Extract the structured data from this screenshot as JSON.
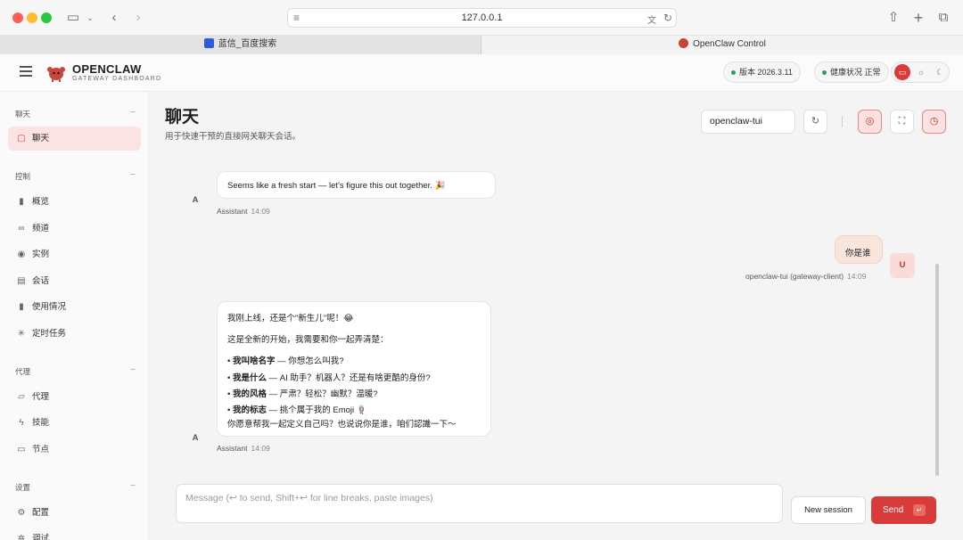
{
  "browser": {
    "url": "127.0.0.1",
    "tabs": [
      {
        "title": "蓝信_百度搜索"
      },
      {
        "title": "OpenClaw Control"
      }
    ]
  },
  "header": {
    "brand": "OPENCLAW",
    "brand_sub": "GATEWAY DASHBOARD",
    "version_label": "版本 2026.3.11",
    "health_label": "健康状况 正常"
  },
  "sidebar": {
    "sections": [
      {
        "title": "聊天",
        "items": [
          {
            "label": "聊天",
            "icon": "chat-icon",
            "active": true
          }
        ]
      },
      {
        "title": "控制",
        "items": [
          {
            "label": "概览",
            "icon": "bar-chart-icon"
          },
          {
            "label": "频道",
            "icon": "link-icon"
          },
          {
            "label": "实例",
            "icon": "broadcast-icon"
          },
          {
            "label": "会话",
            "icon": "document-icon"
          },
          {
            "label": "使用情况",
            "icon": "bar-chart-icon"
          },
          {
            "label": "定时任务",
            "icon": "loader-icon"
          }
        ]
      },
      {
        "title": "代理",
        "items": [
          {
            "label": "代理",
            "icon": "folder-icon"
          },
          {
            "label": "技能",
            "icon": "bolt-icon"
          },
          {
            "label": "节点",
            "icon": "monitor-icon"
          }
        ]
      },
      {
        "title": "设置",
        "items": [
          {
            "label": "配置",
            "icon": "gear-icon"
          },
          {
            "label": "调试",
            "icon": "bug-icon"
          }
        ]
      }
    ]
  },
  "main": {
    "title": "聊天",
    "subtitle": "用于快速干预的直接网关聊天会话。",
    "session_value": "openclaw-tui"
  },
  "messages": [
    {
      "role": "assistant",
      "avatar": "A",
      "lines": [
        "Seems like a fresh start — let's figure this out together. 🎉"
      ],
      "sender": "Assistant",
      "time": "14:09"
    },
    {
      "role": "user",
      "avatar": "U",
      "lines": [
        "你是谁"
      ],
      "sender": "openclaw-tui (gateway-client)",
      "time": "14:09"
    },
    {
      "role": "assistant",
      "avatar": "A",
      "intro": "我刚上线，还是个\"新生儿\"呢！😂",
      "lead": "这是全新的开始，我需要和你一起弄清楚：",
      "bullets": [
        {
          "bold": "我叫啥名字",
          "rest": " — 你想怎么叫我?"
        },
        {
          "bold": "我是什么",
          "rest": " — AI 助手？机器人？还是有啥更酷的身份?"
        },
        {
          "bold": "我的风格",
          "rest": " — 严肃？轻松？幽默？温暖?"
        },
        {
          "bold": "我的标志",
          "rest": " — 挑个属于我的 Emoji 🪢"
        }
      ],
      "closing": "你愿意帮我一起定义自己吗？也说说你是谁，咱们認識一下～",
      "sender": "Assistant",
      "time": "14:09"
    }
  ],
  "composer": {
    "placeholder": "Message (↩ to send, Shift+↩ for line breaks, paste images)",
    "new_session_label": "New session",
    "send_label": "Send",
    "send_kbd": "↵"
  },
  "colors": {
    "accent": "#d93a3a",
    "accent_soft": "#fae3e2",
    "status_ok": "#22a35a"
  }
}
